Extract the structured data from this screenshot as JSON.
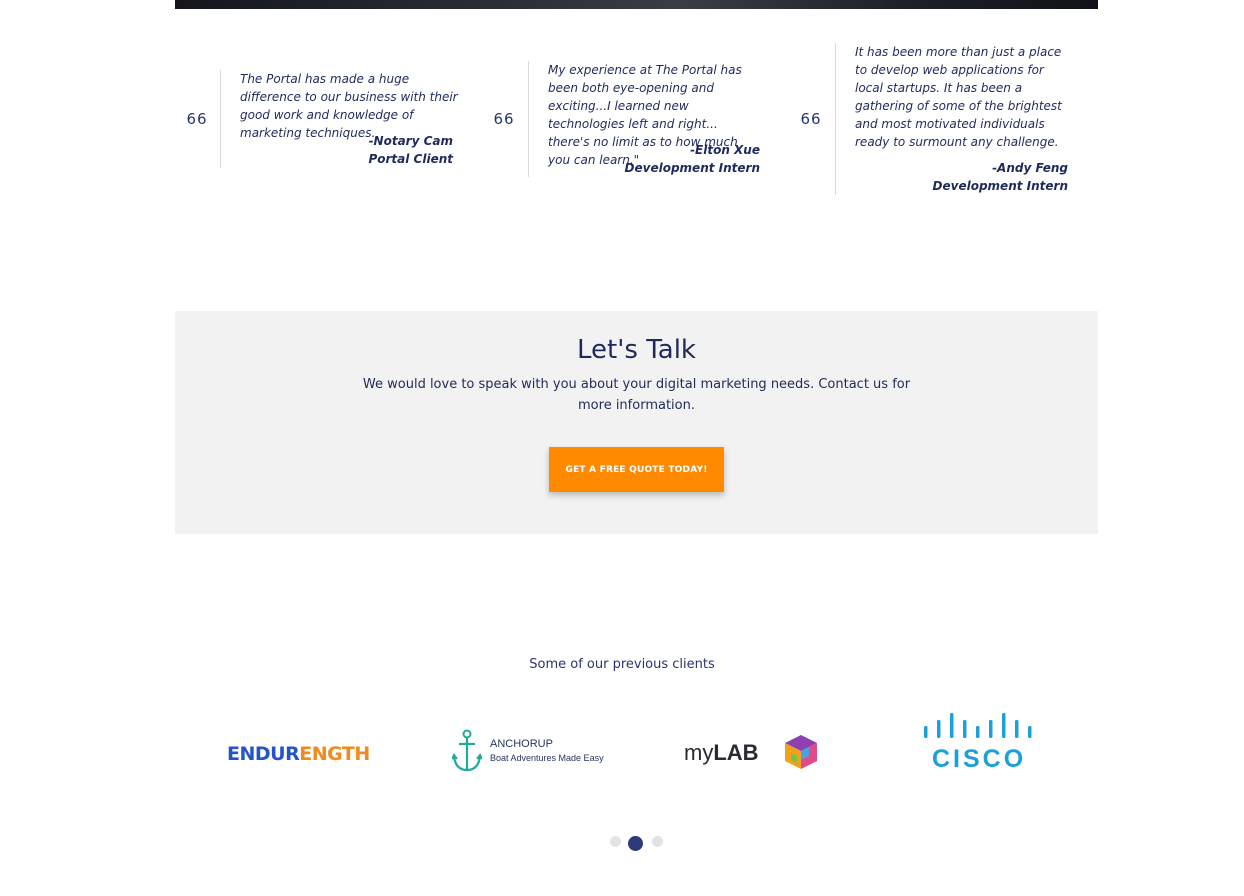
{
  "testimonials": [
    {
      "quote_mark": "66",
      "text": "The Portal has made a huge difference to our business with their good work and knowledge of marketing techniques.",
      "author_name": "-Notary Cam",
      "author_role": "Portal Client"
    },
    {
      "quote_mark": "66",
      "text": "My experience at The Portal has been both eye-opening and exciting...I learned new technologies left and right... there's no limit as to how much you can learn.\"",
      "author_name": "-Elton Xue",
      "author_role": "Development Intern"
    },
    {
      "quote_mark": "66",
      "text": "It has been more than just a place to develop web applications for local startups. It has been a gathering of some of the brightest and most motivated individuals ready to surmount any challenge.",
      "author_name": "-Andy Feng",
      "author_role": "Development Intern"
    }
  ],
  "talk": {
    "title": "Let's Talk",
    "text": "We would love to speak with you about your digital marketing needs. Contact us for more information.",
    "button_label": "GET A FREE QUOTE TODAY!"
  },
  "clients": {
    "heading": "Some of our previous clients",
    "logos": [
      {
        "name": "endurength-logo",
        "text_a": "ENDUR",
        "text_b": "ENGTH"
      },
      {
        "name": "anchorup-logo",
        "title": "ANCHORUP",
        "tagline": "Boat Adventures Made Easy"
      },
      {
        "name": "mylab-logo",
        "text_a": "my",
        "text_b": "LAB"
      },
      {
        "name": "cisco-logo",
        "text": "CISCO"
      }
    ]
  },
  "carousel": {
    "total": 3,
    "active": 2
  },
  "colors": {
    "navy": "#1f2a5c",
    "orange": "#ff8a00",
    "panel_gray": "#f2f2f2",
    "cisco_blue": "#1ba0d7"
  }
}
